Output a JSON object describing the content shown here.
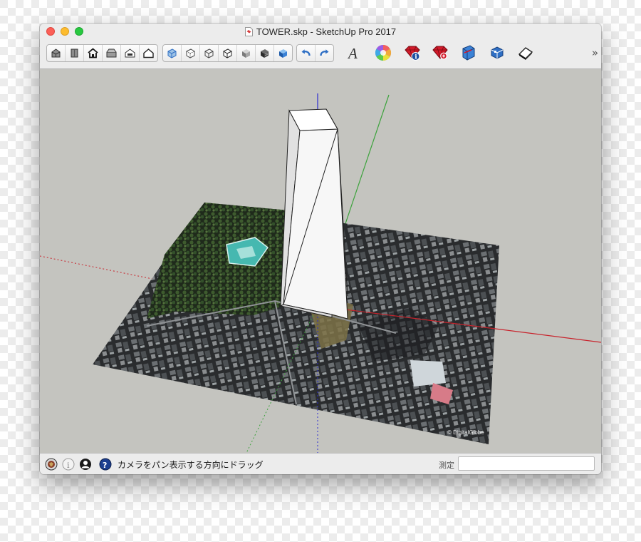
{
  "window": {
    "title": "TOWER.skp - SketchUp Pro 2017"
  },
  "toolbar": {
    "view_group": [
      {
        "icon": "iso-view-icon"
      },
      {
        "icon": "top-view-icon"
      },
      {
        "icon": "front-view-icon"
      },
      {
        "icon": "right-view-icon"
      },
      {
        "icon": "back-view-icon"
      },
      {
        "icon": "left-view-icon"
      }
    ],
    "style_group": [
      {
        "icon": "xray-style-icon"
      },
      {
        "icon": "back-edges-style-icon"
      },
      {
        "icon": "wireframe-style-icon"
      },
      {
        "icon": "hidden-line-style-icon"
      },
      {
        "icon": "shaded-style-icon"
      },
      {
        "icon": "shaded-textures-style-icon"
      },
      {
        "icon": "monochrome-style-icon"
      }
    ],
    "undo_group": [
      {
        "icon": "undo-icon"
      },
      {
        "icon": "redo-icon"
      }
    ],
    "tools": [
      {
        "icon": "text-style-icon"
      },
      {
        "icon": "color-wheel-icon"
      },
      {
        "icon": "model-info-icon"
      },
      {
        "icon": "extension-warehouse-icon"
      },
      {
        "icon": "section-plane-icon"
      },
      {
        "icon": "component-icon"
      },
      {
        "icon": "eraser-icon"
      }
    ],
    "overflow_label": "»",
    "colors": {
      "accent_blue": "#3b82d6",
      "ruby_red": "#d21a2a",
      "blue_icon": "#2f6fc4"
    }
  },
  "viewport": {
    "colors": {
      "background": "#c4c4bf",
      "red_axis": "#c8232c",
      "green_axis": "#3da33d",
      "blue_axis": "#2b2bd1",
      "tower_face": "#f7f7f7"
    },
    "watermark": "© DigitalGlobe"
  },
  "status": {
    "icons": [
      "geo-location-icon",
      "credits-info-icon",
      "user-account-icon",
      "instructor-help-icon"
    ],
    "message": "カメラをパン表示する方向にドラッグ",
    "measure_label": "測定",
    "measure_value": ""
  }
}
